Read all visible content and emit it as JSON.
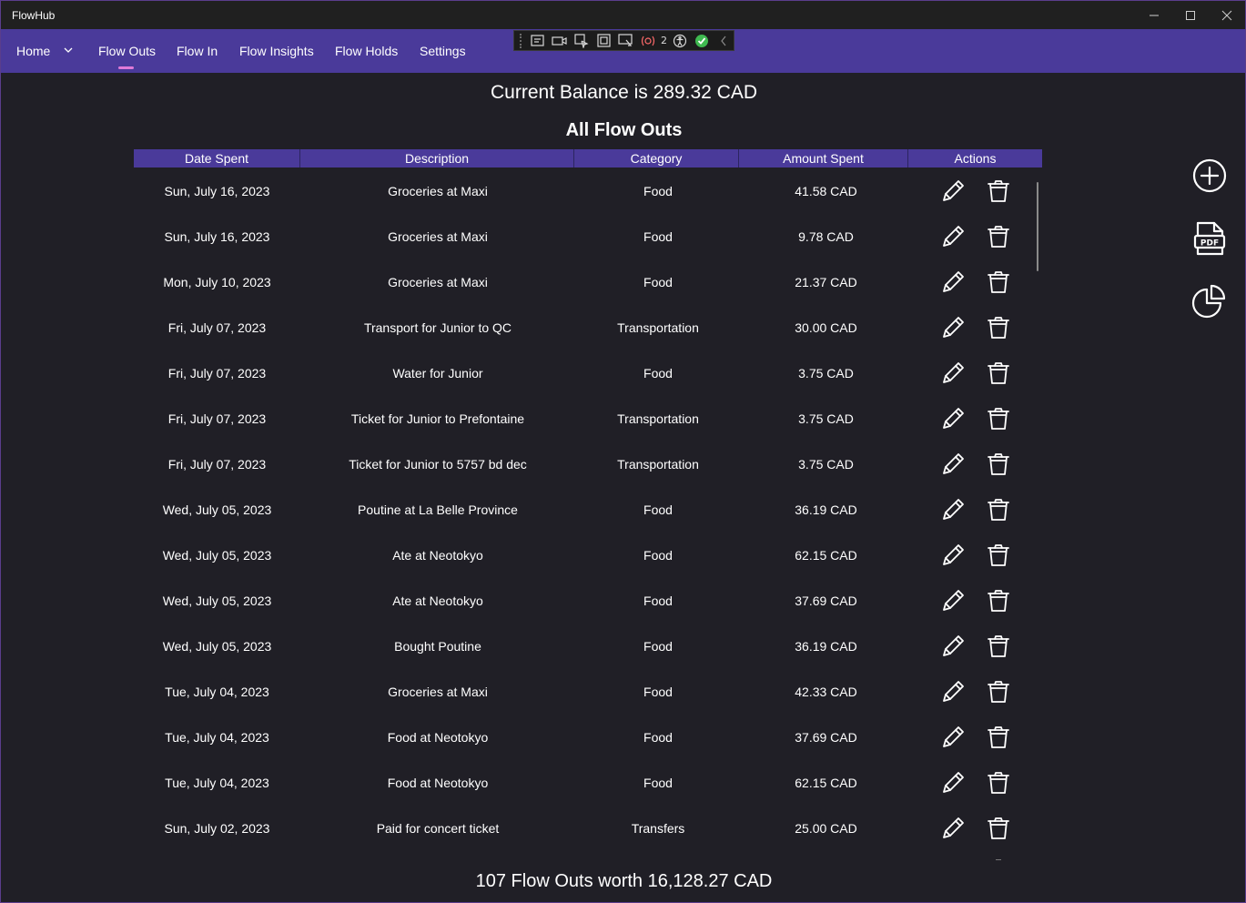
{
  "window": {
    "title": "FlowHub"
  },
  "nav": {
    "items": [
      {
        "label": "Home"
      },
      {
        "label": "Flow Outs"
      },
      {
        "label": "Flow In"
      },
      {
        "label": "Flow Insights"
      },
      {
        "label": "Flow Holds"
      },
      {
        "label": "Settings"
      }
    ],
    "active": "Flow Outs"
  },
  "devtoolbar": {
    "binding_errors": "2"
  },
  "summary": {
    "balance": "Current Balance is 289.32 CAD",
    "section_title": "All Flow Outs",
    "footer": "107 Flow Outs worth 16,128.27 CAD"
  },
  "table": {
    "headers": [
      "Date Spent",
      "Description",
      "Category",
      "Amount Spent",
      "Actions"
    ],
    "rows": [
      {
        "date": "Sun, July 16, 2023",
        "description": "Groceries at Maxi",
        "category": "Food",
        "amount": "41.58 CAD"
      },
      {
        "date": "Sun, July 16, 2023",
        "description": "Groceries at Maxi",
        "category": "Food",
        "amount": "9.78 CAD"
      },
      {
        "date": "Mon, July 10, 2023",
        "description": "Groceries at Maxi",
        "category": "Food",
        "amount": "21.37 CAD"
      },
      {
        "date": "Fri, July 07, 2023",
        "description": "Transport for Junior to QC",
        "category": "Transportation",
        "amount": "30.00 CAD"
      },
      {
        "date": "Fri, July 07, 2023",
        "description": "Water for Junior",
        "category": "Food",
        "amount": "3.75 CAD"
      },
      {
        "date": "Fri, July 07, 2023",
        "description": "Ticket for Junior to Prefontaine",
        "category": "Transportation",
        "amount": "3.75 CAD"
      },
      {
        "date": "Fri, July 07, 2023",
        "description": "Ticket for Junior to 5757 bd dec",
        "category": "Transportation",
        "amount": "3.75 CAD"
      },
      {
        "date": "Wed, July 05, 2023",
        "description": "Poutine at La Belle Province",
        "category": "Food",
        "amount": "36.19 CAD"
      },
      {
        "date": "Wed, July 05, 2023",
        "description": "Ate at Neotokyo",
        "category": "Food",
        "amount": "62.15 CAD"
      },
      {
        "date": "Wed, July 05, 2023",
        "description": "Ate at Neotokyo",
        "category": "Food",
        "amount": "37.69 CAD"
      },
      {
        "date": "Wed, July 05, 2023",
        "description": "Bought Poutine",
        "category": "Food",
        "amount": "36.19 CAD"
      },
      {
        "date": "Tue, July 04, 2023",
        "description": "Groceries at Maxi",
        "category": "Food",
        "amount": "42.33 CAD"
      },
      {
        "date": "Tue, July 04, 2023",
        "description": "Food at Neotokyo",
        "category": "Food",
        "amount": "37.69 CAD"
      },
      {
        "date": "Tue, July 04, 2023",
        "description": "Food at Neotokyo",
        "category": "Food",
        "amount": "62.15 CAD"
      },
      {
        "date": "Sun, July 02, 2023",
        "description": "Paid for concert ticket",
        "category": "Transfers",
        "amount": "25.00 CAD"
      }
    ]
  },
  "side_actions": [
    {
      "icon": "add-circle-icon"
    },
    {
      "icon": "pdf-file-icon"
    },
    {
      "icon": "pie-chart-icon"
    }
  ],
  "colors": {
    "navbar": "#4a3a9a",
    "background": "#201f26",
    "accent_indicator": "#e07ad8"
  }
}
